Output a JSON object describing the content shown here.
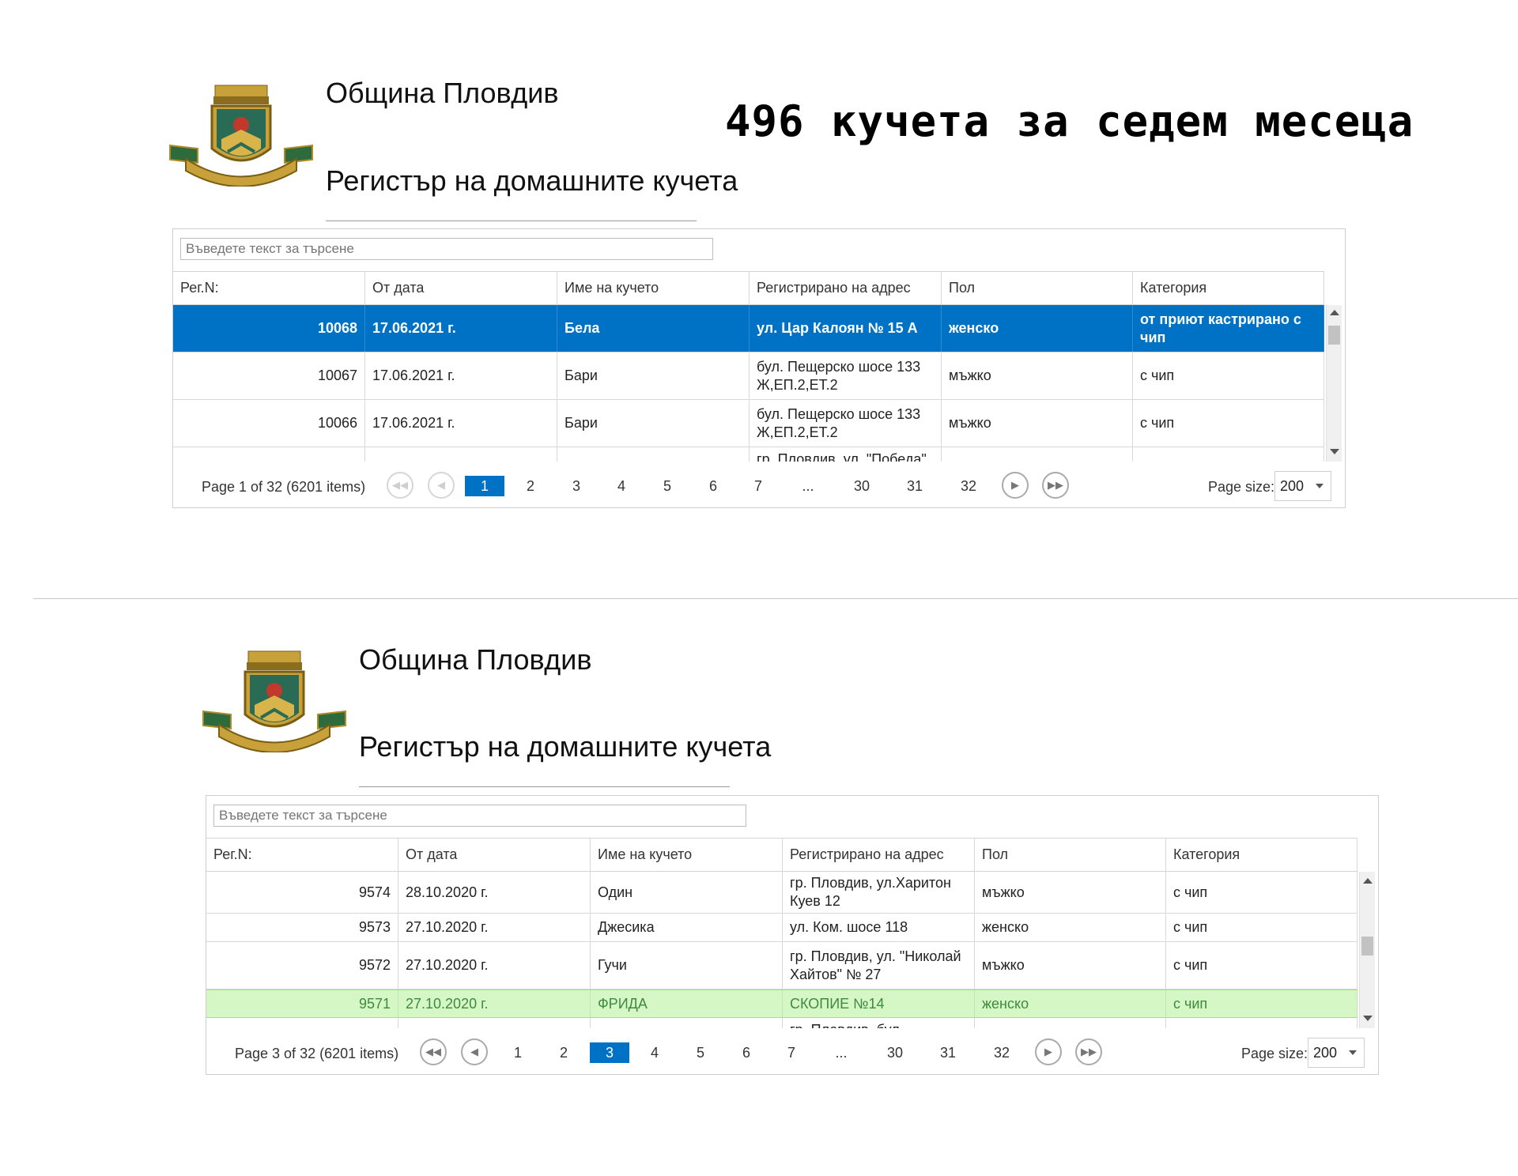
{
  "headline": "496 кучета за седем месеца",
  "screens": [
    {
      "municipality": "Община Пловдив",
      "register_title": "Регистър на домашните кучета",
      "search_placeholder": "Въведете текст за търсене",
      "columns": [
        "Рег.N:",
        "От дата",
        "Име на кучето",
        "Регистрирано на адрес",
        "Пол",
        "Категория"
      ],
      "rows": [
        {
          "reg": "10068",
          "date": "17.06.2021 г.",
          "name": "Бела",
          "address": "ул. Цар Калоян № 15 А",
          "sex": "женско",
          "category": "от приют кастрирано с чип"
        },
        {
          "reg": "10067",
          "date": "17.06.2021 г.",
          "name": "Бари",
          "address": "бул. Пещерско шосе 133 Ж,ЕП.2,ЕТ.2",
          "sex": "мъжко",
          "category": "с чип"
        },
        {
          "reg": "10066",
          "date": "17.06.2021 г.",
          "name": "Бари",
          "address": "бул. Пещерско шосе 133 Ж,ЕП.2,ЕТ.2",
          "sex": "мъжко",
          "category": "с чип"
        },
        {
          "reg": "",
          "date": "",
          "name": "",
          "address": "гр. Пловдив, ул. \"Победа\"",
          "sex": "",
          "category": ""
        }
      ],
      "page_info": "Page 1 of 32 (6201 items)",
      "pages": [
        "1",
        "2",
        "3",
        "4",
        "5",
        "6",
        "7",
        "...",
        "30",
        "31",
        "32"
      ],
      "current_page": "1",
      "page_size_label": "Page size:",
      "page_size": "200"
    },
    {
      "municipality": "Община Пловдив",
      "register_title": "Регистър на домашните кучета",
      "search_placeholder": "Въведете текст за търсене",
      "columns": [
        "Рег.N:",
        "От дата",
        "Име на кучето",
        "Регистрирано на адрес",
        "Пол",
        "Категория"
      ],
      "rows": [
        {
          "reg": "9574",
          "date": "28.10.2020 г.",
          "name": "Один",
          "address": "гр. Пловдив, ул.Харитон Куев 12",
          "sex": "мъжко",
          "category": "с чип"
        },
        {
          "reg": "9573",
          "date": "27.10.2020 г.",
          "name": "Джесика",
          "address": "ул. Ком. шосе 118",
          "sex": "женско",
          "category": "с чип"
        },
        {
          "reg": "9572",
          "date": "27.10.2020 г.",
          "name": "Гучи",
          "address": "гр. Пловдив, ул. \"Николай Хайтов\" № 27",
          "sex": "мъжко",
          "category": "с чип"
        },
        {
          "reg": "9571",
          "date": "27.10.2020 г.",
          "name": "ФРИДА",
          "address": "СКОПИЕ №14",
          "sex": "женско",
          "category": "с чип"
        },
        {
          "reg": "",
          "date": "",
          "name": "",
          "address": "гр. Пловдив, бул.",
          "sex": "",
          "category": ""
        }
      ],
      "page_info": "Page 3 of 32 (6201 items)",
      "pages": [
        "1",
        "2",
        "3",
        "4",
        "5",
        "6",
        "7",
        "...",
        "30",
        "31",
        "32"
      ],
      "current_page": "3",
      "page_size_label": "Page size:",
      "page_size": "200"
    }
  ],
  "colors": {
    "selected_row": "#0072c6",
    "focused_row": "#d5f6c5",
    "current_page": "#0072c6"
  },
  "icons": [
    "coat-of-arms",
    "first-page-icon",
    "prev-page-icon",
    "next-page-icon",
    "last-page-icon",
    "dropdown-caret-icon",
    "scroll-up-icon",
    "scroll-down-icon"
  ]
}
